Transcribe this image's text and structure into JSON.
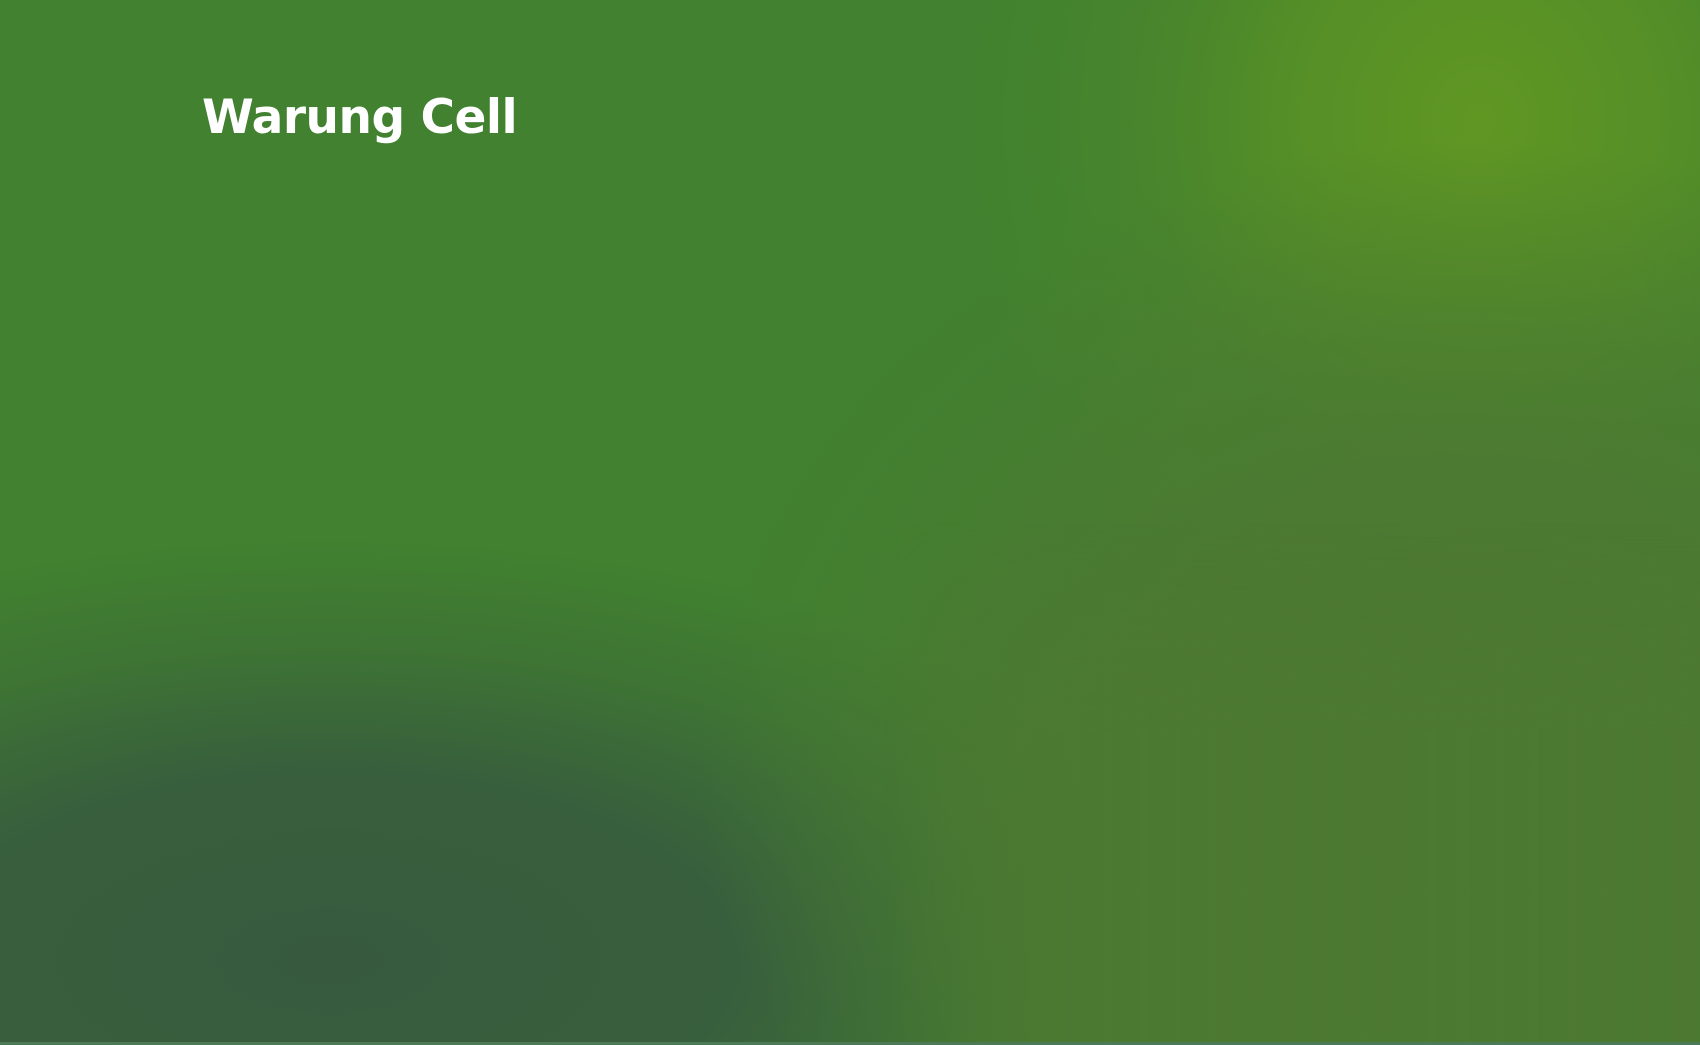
{
  "header": {
    "brand_title": "Warung Cell"
  },
  "colors": {
    "base_green": "#41812f",
    "lime_highlight": "#5f9822",
    "olive_green": "#4c7932",
    "dark_teal": "#375c3e",
    "text": "#ffffff"
  }
}
